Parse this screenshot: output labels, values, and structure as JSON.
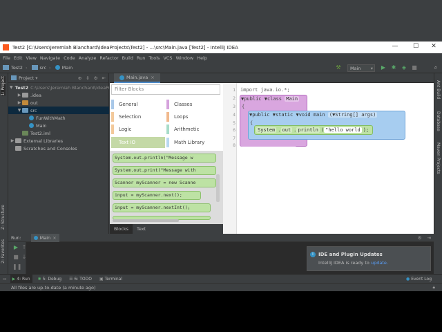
{
  "window": {
    "title": "Test2 [C:\\Users\\Jeremiah Blanchard\\IdeaProjects\\Test2] - ...\\src\\Main.java [Test2] - IntelliJ IDEA",
    "minimize": "—",
    "maximize": "☐",
    "close": "✕"
  },
  "menu": [
    "File",
    "Edit",
    "View",
    "Navigate",
    "Code",
    "Analyze",
    "Refactor",
    "Build",
    "Run",
    "Tools",
    "VCS",
    "Window",
    "Help"
  ],
  "navbar": {
    "crumbs": [
      "Test2",
      "src",
      "Main"
    ],
    "run_config": "Main"
  },
  "left_stripe": {
    "project": "1: Project",
    "structure": "Z: Structure",
    "favorites": "2: Favorites"
  },
  "right_stripe": {
    "ant": "Ant Build",
    "database": "Database",
    "maven": "Maven Projects"
  },
  "project_panel": {
    "title": "Project",
    "tree": [
      {
        "label": "Test2",
        "path": "C:\\Users\\Jeremiah Blanchard\\IdeaProjects\\Test2"
      },
      {
        "label": ".idea"
      },
      {
        "label": "out"
      },
      {
        "label": "src"
      },
      {
        "label": "FunWithMath"
      },
      {
        "label": "Main"
      },
      {
        "label": "Test2.iml"
      },
      {
        "label": "External Libraries"
      },
      {
        "label": "Scratches and Consoles"
      }
    ]
  },
  "editor": {
    "tab": "Main.java"
  },
  "palette": {
    "filter_placeholder": "Filter Blocks",
    "categories": [
      {
        "label": "General",
        "color": "#a9c8e8"
      },
      {
        "label": "Classes",
        "color": "#d5a2dc"
      },
      {
        "label": "Selection",
        "color": "#f3c99b"
      },
      {
        "label": "Loops",
        "color": "#f1b98d"
      },
      {
        "label": "Logic",
        "color": "#f3c99b"
      },
      {
        "label": "Arithmetic",
        "color": "#a7dcc9"
      },
      {
        "label": "Text IO",
        "color": "#c4d9a6"
      },
      {
        "label": "Math Library",
        "color": "#b8d8f0"
      }
    ],
    "blocks": [
      "System.out.println(\"Message w",
      "System.out.print(\"Message with",
      "Scanner myScanner = new Scanne",
      "input = myScanner.next();",
      "input = myScanner.nextInt();"
    ],
    "tabs": [
      "Blocks",
      "Text"
    ]
  },
  "code": {
    "line_numbers": [
      "1",
      "2",
      "3",
      "4",
      "5",
      "6",
      "7",
      "8"
    ],
    "import": "import java.io.*;",
    "class_public": "public",
    "class_kw": "class",
    "class_name": "Main",
    "brace_open": "{",
    "m_public": "public",
    "m_static": "static",
    "m_void": "void",
    "m_name": "main",
    "m_param_type": "String[]",
    "m_param": "args)",
    "stmt_sys": "System",
    "stmt_out": "out",
    "stmt_println": "println",
    "stmt_arg": "\"hello world",
    "stmt_end": ");"
  },
  "run_panel": {
    "label": "Run:",
    "tab": "Main",
    "notification": {
      "title": "IDE and Plugin Updates",
      "body_prefix": "IntelliJ IDEA is ready to",
      "link": "update."
    }
  },
  "tool_tabs": [
    "4: Run",
    "5: Debug",
    "6: TODO",
    "Terminal"
  ],
  "event_log": "Event Log",
  "status": "All files are up-to-date (a minute ago)"
}
